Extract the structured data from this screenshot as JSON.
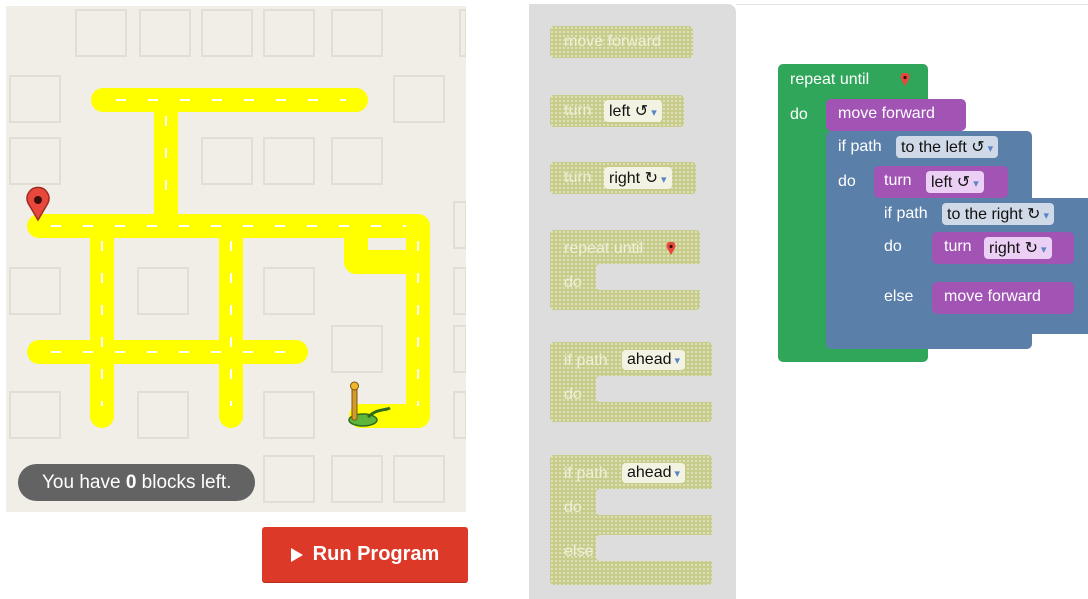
{
  "status": {
    "prefix": "You have ",
    "count": "0",
    "suffix": " blocks left."
  },
  "run_button": {
    "label": "Run Program"
  },
  "toolbox": {
    "move_forward": "move forward",
    "turn": "turn",
    "left": "left ↺",
    "right": "right ↻",
    "repeat_until": "repeat until",
    "do": "do",
    "if_path": "if path",
    "ahead": "ahead",
    "else": "else"
  },
  "workspace": {
    "repeat_until": "repeat until",
    "do": "do",
    "move_forward": "move forward",
    "if_path": "if path",
    "to_the_left": "to the left ↺",
    "to_the_right": "to the right ↻",
    "turn": "turn",
    "left": "left ↺",
    "right": "right ↻",
    "else": "else"
  },
  "colors": {
    "path": "#ffff00",
    "loop": "#2fa659",
    "logic": "#5a7fa8",
    "action": "#a254b5",
    "run": "#dd3928"
  }
}
